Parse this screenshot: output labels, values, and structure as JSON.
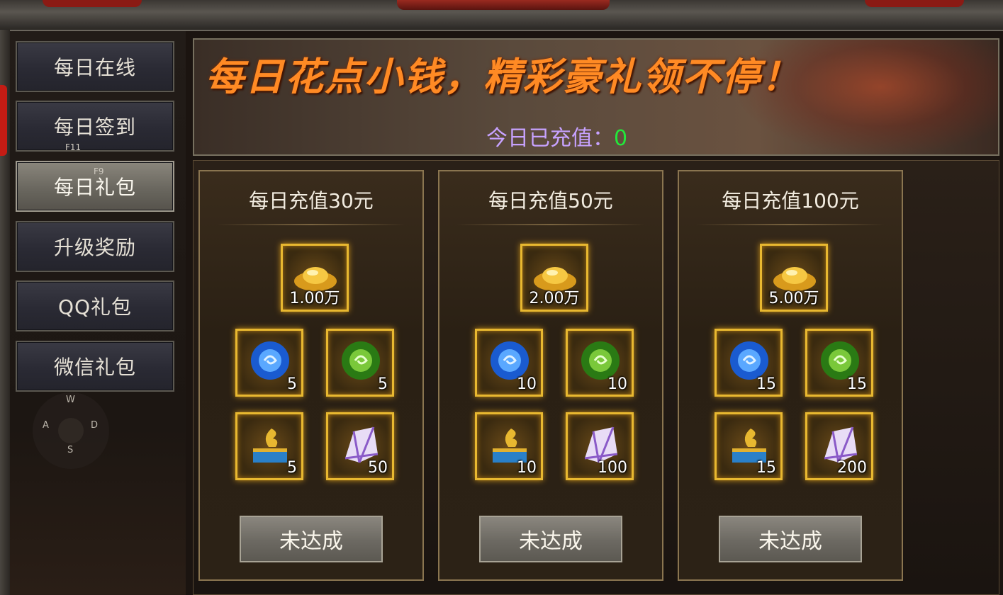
{
  "sidebar": {
    "items": [
      {
        "label": "每日在线"
      },
      {
        "label": "每日签到"
      },
      {
        "label": "每日礼包"
      },
      {
        "label": "升级奖励"
      },
      {
        "label": "QQ礼包"
      },
      {
        "label": "微信礼包"
      }
    ],
    "active_index": 2,
    "hotkeys": [
      "F11",
      "F9"
    ]
  },
  "compass": {
    "n": "W",
    "w": "A",
    "e": "D",
    "s": "S"
  },
  "banner": {
    "title": "每日花点小钱，精彩豪礼领不停！",
    "recharge_label": "今日已充值：",
    "recharge_value": "0"
  },
  "colors": {
    "accent_orange": "#ff8a24",
    "recharge_label": "#c7a2ff",
    "recharge_value": "#22e83a",
    "slot_border": "#e8b830"
  },
  "tiers": [
    {
      "title": "每日充值30元",
      "gold": "1.00万",
      "items": [
        {
          "icon": "blue-gem-icon",
          "qty": "5"
        },
        {
          "icon": "green-gem-icon",
          "qty": "5"
        },
        {
          "icon": "dragon-chest-icon",
          "qty": "5"
        },
        {
          "icon": "purple-crystal-icon",
          "qty": "50"
        }
      ],
      "button": "未达成"
    },
    {
      "title": "每日充值50元",
      "gold": "2.00万",
      "items": [
        {
          "icon": "blue-gem-icon",
          "qty": "10"
        },
        {
          "icon": "green-gem-icon",
          "qty": "10"
        },
        {
          "icon": "dragon-chest-icon",
          "qty": "10"
        },
        {
          "icon": "purple-crystal-icon",
          "qty": "100"
        }
      ],
      "button": "未达成"
    },
    {
      "title": "每日充值100元",
      "gold": "5.00万",
      "items": [
        {
          "icon": "blue-gem-icon",
          "qty": "15"
        },
        {
          "icon": "green-gem-icon",
          "qty": "15"
        },
        {
          "icon": "dragon-chest-icon",
          "qty": "15"
        },
        {
          "icon": "purple-crystal-icon",
          "qty": "200"
        }
      ],
      "button": "未达成"
    }
  ]
}
